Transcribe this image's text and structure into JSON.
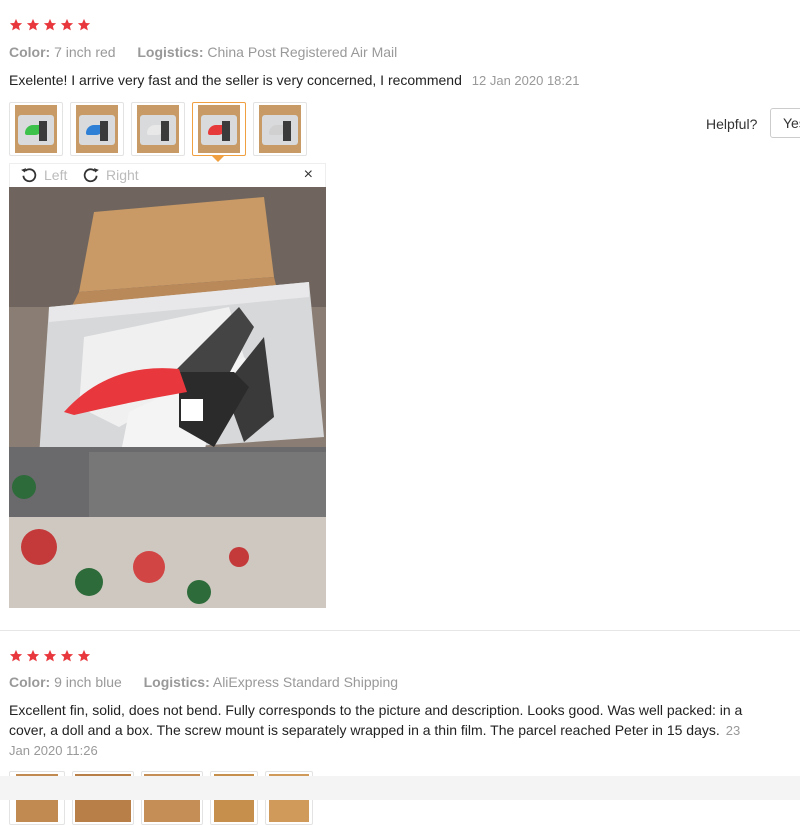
{
  "reviews": [
    {
      "rating": 5,
      "color_label": "Color:",
      "color_value": "7 inch red",
      "logistics_label": "Logistics:",
      "logistics_value": "China Post Registered Air Mail",
      "text": "Exelente! I arrive very fast and the seller is very concerned, I recommend",
      "date": "12 Jan 2020 18:21",
      "thumbnails": [
        {
          "fin_color": "#3cc24a"
        },
        {
          "fin_color": "#2e7fd6"
        },
        {
          "fin_color": "#e8e8e8"
        },
        {
          "fin_color": "#e63a3a",
          "active": true
        },
        {
          "fin_color": "#d0d0d0"
        }
      ]
    },
    {
      "rating": 5,
      "color_label": "Color:",
      "color_value": "9 inch blue",
      "logistics_label": "Logistics:",
      "logistics_value": "AliExpress Standard Shipping",
      "text_line1": "Excellent fin, solid, does not bend. Fully corresponds to the picture and description. Looks good. Was well packed: in a",
      "text_line2": "cover, a doll and a box. The screw mount is separately wrapped in a thin film. The parcel reached Peter in 15 days.",
      "date_part1": "23",
      "date_part2": "Jan 2020 11:26"
    }
  ],
  "helpful": {
    "label": "Helpful?",
    "yes": "Yes"
  },
  "viewer": {
    "left": "Left",
    "right": "Right",
    "close": "×"
  },
  "colors": {
    "star": "#e8383d",
    "accent": "#f0a040",
    "muted": "#999999"
  }
}
